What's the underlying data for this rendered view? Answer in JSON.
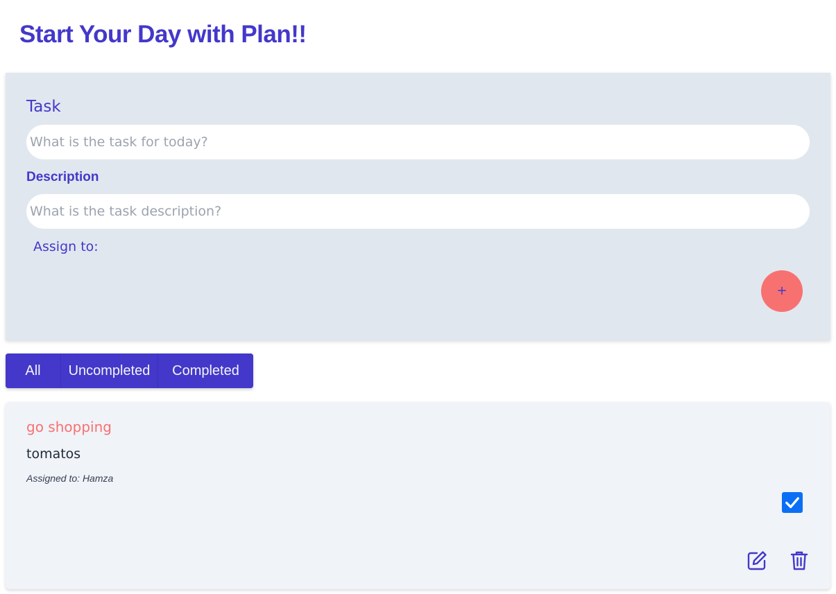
{
  "header": {
    "title": "Start Your Day with Plan!!"
  },
  "form": {
    "task_label": "Task",
    "task_placeholder": "What is the task for today?",
    "description_label": "Description",
    "description_placeholder": "What is the task description?",
    "assign_label": "Assign to:",
    "add_button_label": "+"
  },
  "filters": [
    {
      "label": "All"
    },
    {
      "label": "Uncompleted"
    },
    {
      "label": "Completed"
    }
  ],
  "tasks": [
    {
      "title": "go shopping",
      "description": "tomatos",
      "assigned": "Assigned to: Hamza",
      "completed": true,
      "icons": {
        "checkbox": "checkmark-icon",
        "edit": "edit-icon",
        "delete": "trash-icon"
      }
    }
  ],
  "colors": {
    "accent": "#4338ca",
    "panel": "#e1e7ef",
    "task_card": "#f0f3f8",
    "add_button": "#f87171",
    "task_title": "#f87171",
    "checkbox": "#0b6ff5"
  }
}
